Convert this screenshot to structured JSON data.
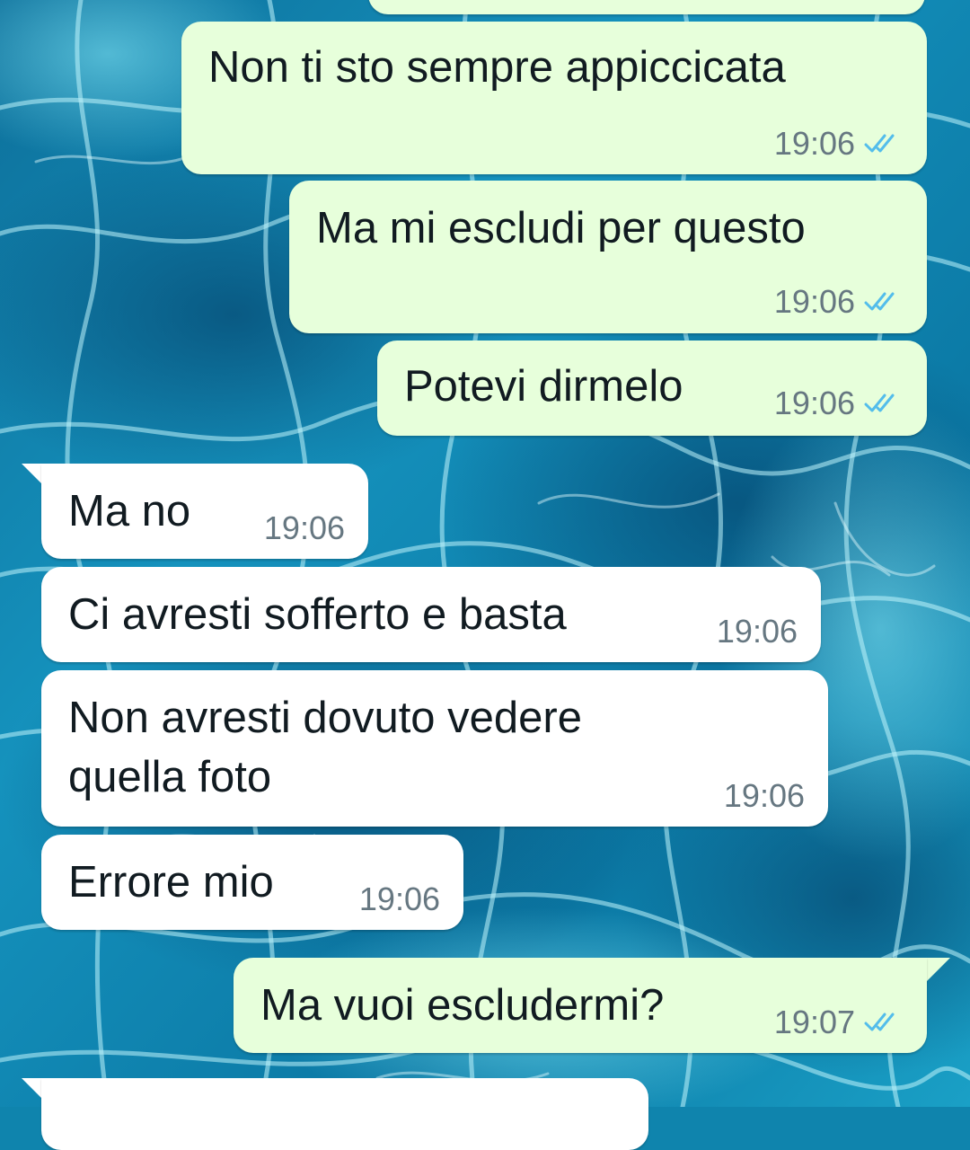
{
  "colors": {
    "outgoing_bubble": "#e7ffdb",
    "incoming_bubble": "#ffffff",
    "read_ticks": "#53bdeb",
    "timestamp": "#667781",
    "wallpaper": "#0f84ad"
  },
  "wallpaper": {
    "description_icon": "pool-water-wallpaper"
  },
  "messages": [
    {
      "direction": "outgoing",
      "text": "Non ti sto sempre appiccicata",
      "time": "19:06",
      "status": "read"
    },
    {
      "direction": "outgoing",
      "text": "Ma mi escludi per questo",
      "time": "19:06",
      "status": "read"
    },
    {
      "direction": "outgoing",
      "text": "Potevi dirmelo",
      "time": "19:06",
      "status": "read"
    },
    {
      "direction": "incoming",
      "text": "Ma no",
      "time": "19:06"
    },
    {
      "direction": "incoming",
      "text": "Ci avresti sofferto e basta",
      "time": "19:06"
    },
    {
      "direction": "incoming",
      "text_line1": "Non avresti dovuto vedere",
      "text_line2": "quella foto",
      "time": "19:06"
    },
    {
      "direction": "incoming",
      "text": "Errore mio",
      "time": "19:06"
    },
    {
      "direction": "outgoing",
      "text": "Ma vuoi escludermi?",
      "time": "19:07",
      "status": "read"
    }
  ]
}
